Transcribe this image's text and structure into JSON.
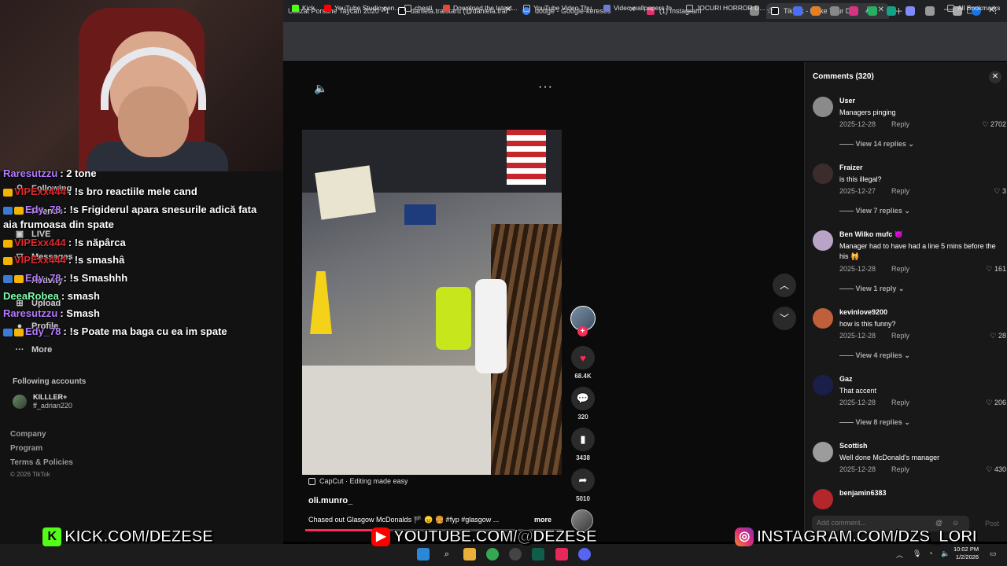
{
  "browser": {
    "tabs": [
      {
        "title": "Utilizat Porsche Taycan 2020 - 1",
        "favicon_color": "#f2f2f2"
      },
      {
        "title": "daniela.traistaru (@daniela.trai",
        "favicon_color": "#ffffff"
      },
      {
        "title": "dodge - Google-keresés",
        "favicon_color": "#4285f4"
      },
      {
        "title": "(1) Instagram",
        "favicon_color": "#e1306c"
      },
      {
        "title": "TikTok - Make Your Day",
        "favicon_color": "#ffffff"
      }
    ],
    "bookmarks": [
      {
        "label": "Kick",
        "color": "#53fc18"
      },
      {
        "label": "YouTube Studio pen...",
        "color": "#ff0000"
      },
      {
        "label": "chesti",
        "color": "#bdbdbd"
      },
      {
        "label": "Download the latest...",
        "color": "#e04b3a"
      },
      {
        "label": "YouTube Video Thu...",
        "color": "#bdbdbd"
      },
      {
        "label": "Video wallpapers fo...",
        "color": "#6d7bd9"
      },
      {
        "label": "JOCURI HORROR D...",
        "color": "#bdbdbd"
      }
    ],
    "all_bookmarks": "All Bookmarks"
  },
  "sidebar": {
    "nav": [
      {
        "label": "Following",
        "icon": "person-icon"
      },
      {
        "label": "Friends",
        "icon": "friends-icon"
      },
      {
        "label": "LIVE",
        "icon": "live-icon"
      },
      {
        "label": "Messages",
        "icon": "message-icon"
      },
      {
        "label": "Activity",
        "icon": "bell-icon"
      },
      {
        "label": "Upload",
        "icon": "upload-icon"
      },
      {
        "label": "Profile",
        "icon": "profile-icon"
      },
      {
        "label": "More",
        "icon": "more-icon"
      }
    ],
    "following_title": "Following accounts",
    "account": {
      "name": "KILLLER+",
      "handle": "ff_adrian220"
    },
    "footer": [
      "Company",
      "Program",
      "Terms & Policies"
    ],
    "copyright": "© 2026 TikTok"
  },
  "chat": [
    {
      "user": "Raresutzzu",
      "text": ": 2 tone",
      "color": "#b57cff",
      "badges": 0
    },
    {
      "user": "VIPExx444",
      "text": ": !s bro reactiile mele cand",
      "color": "#e0292d",
      "badges": 1
    },
    {
      "user": "Edy_78",
      "text": ": !s Frigiderul apara snesurile adică fata",
      "color": "#b57cff",
      "badges": 2
    },
    {
      "user": "",
      "text": "aia frumoasa din spate",
      "color": "#ffffff",
      "badges": 0
    },
    {
      "user": "VIPExx444",
      "text": ": !s năpârca",
      "color": "#e0292d",
      "badges": 1
    },
    {
      "user": "VIPExx444",
      "text": ": !s smashâ",
      "color": "#e0292d",
      "badges": 1
    },
    {
      "user": "Edy_78",
      "text": ": !s Smashhh",
      "color": "#b57cff",
      "badges": 2
    },
    {
      "user": "DeeaRobea",
      "text": ": smash",
      "color": "#7dffb0",
      "badges": 0
    },
    {
      "user": "Raresutzzu",
      "text": ": Smash",
      "color": "#b57cff",
      "badges": 0
    },
    {
      "user": "Edy_78",
      "text": ": !s Poate ma baga cu ea im spate",
      "color": "#b57cff",
      "badges": 2
    }
  ],
  "video": {
    "capcut": "CapCut · Editing made easy",
    "author": "oli.munro_",
    "caption": "Chased out Glasgow McDonalds 🏴 😠 🍔 #fyp #glasgow ...",
    "more": "more",
    "progress": 0.27,
    "likes": "68.4K",
    "comments": "320",
    "saves": "3438",
    "shares": "5010"
  },
  "comments_panel": {
    "title": "Comments (320)",
    "items": [
      {
        "user": "User",
        "text": "Managers pinging",
        "date": "2025-12-28",
        "likes": "2702",
        "replies": "View 14 replies",
        "avatar": "#8a8a8a"
      },
      {
        "user": "Fraizer",
        "text": "is this illegal?",
        "date": "2025-12-27",
        "likes": "3",
        "replies": "View 7 replies",
        "avatar": "#3d2c2c"
      },
      {
        "user": "Ben Wilko mufc 👿",
        "text": "Manager had to have had a line 5 mins before the his 🙀",
        "date": "2025-12-28",
        "likes": "161",
        "replies": "View 1 reply",
        "avatar": "#b9a4c8"
      },
      {
        "user": "kevinlove9200",
        "text": "how is this funny?",
        "date": "2025-12-28",
        "likes": "28",
        "replies": "View 4 replies",
        "avatar": "#c0603a"
      },
      {
        "user": "Gaz",
        "text": "That accent",
        "date": "2025-12-28",
        "likes": "206",
        "replies": "View 8 replies",
        "avatar": "#1a1f4a"
      },
      {
        "user": "Scottish",
        "text": "Well done McDonald's manager",
        "date": "2025-12-28",
        "likes": "430",
        "replies": "",
        "avatar": "#9c9c9c"
      },
      {
        "user": "benjamin6383",
        "text": "",
        "date": "",
        "likes": "",
        "replies": "",
        "avatar": "#b3262b"
      }
    ],
    "reply_label": "Reply",
    "add_placeholder": "Add comment...",
    "post": "Post"
  },
  "overlays": {
    "kick": "KICK.COM/DEZESE",
    "youtube": "YOUTUBE.COM/@DEZESE",
    "instagram": "INSTAGRAM.COM/DZS_LORI"
  },
  "taskbar": {
    "time": "10:02 PM",
    "date": "1/2/2026"
  }
}
